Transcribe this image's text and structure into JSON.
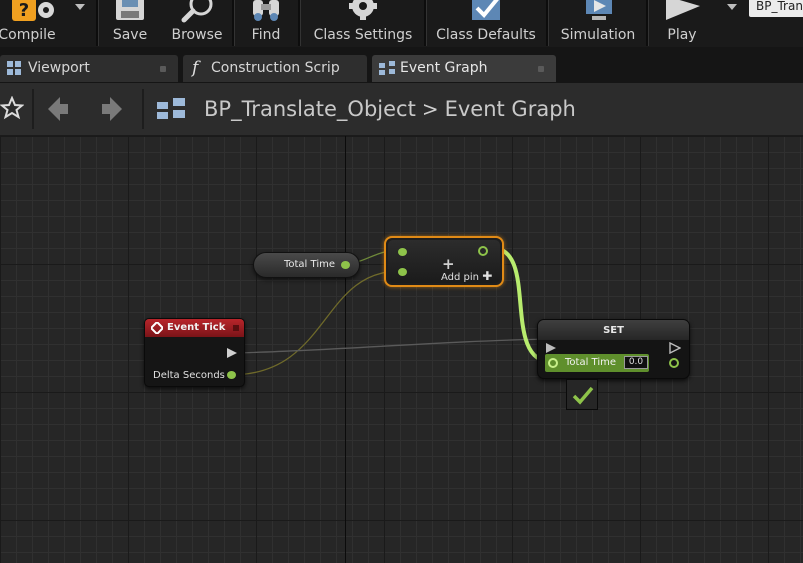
{
  "toolbar": {
    "compile_label": "Compile",
    "save_label": "Save",
    "browse_label": "Browse",
    "find_label": "Find",
    "class_settings_label": "Class Settings",
    "class_defaults_label": "Class Defaults",
    "simulation_label": "Simulation",
    "play_label": "Play",
    "debug_object": "BP_Trans"
  },
  "tabs": [
    {
      "label": "Viewport",
      "icon": "viewport-icon"
    },
    {
      "label": "Construction Scrip",
      "icon": "function-icon"
    },
    {
      "label": "Event Graph",
      "icon": "graph-icon",
      "active": true
    }
  ],
  "nav": {
    "breadcrumb": [
      "BP_Translate_Object",
      "Event Graph"
    ],
    "separator": ">"
  },
  "graph": {
    "variable_node": {
      "label": "Total Time"
    },
    "add_node": {
      "symbol": "+",
      "add_pin_label": "Add pin"
    },
    "event_tick": {
      "title": "Event Tick",
      "output_label": "Delta Seconds"
    },
    "set_node": {
      "title": "SET",
      "pin_label": "Total Time",
      "value": "0.0"
    }
  },
  "colors": {
    "accent_selected": "#e08a16",
    "float_pin": "#8ec34a",
    "event_header": "#b8252b",
    "compile_ok": "#8ec34a"
  }
}
